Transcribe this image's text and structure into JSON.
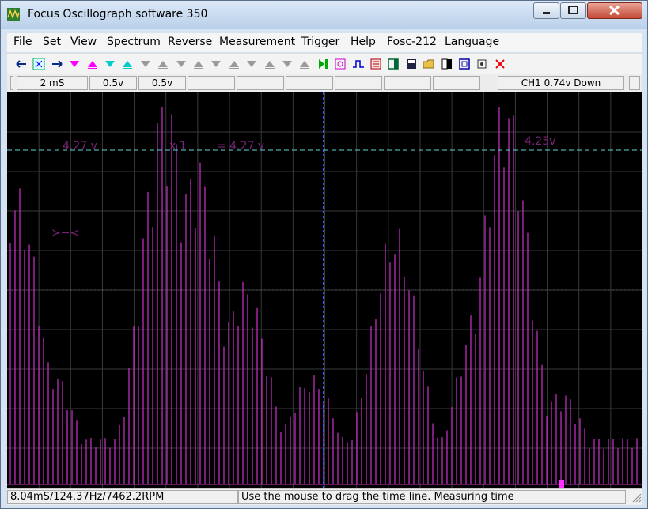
{
  "window": {
    "title": "Focus Oscillograph software 350"
  },
  "menu": [
    "File",
    "Set",
    "View",
    "Spectrum",
    "Reverse",
    "Measurement",
    "Trigger",
    "Help",
    "Fosc-212",
    "Language"
  ],
  "toolbar_icons": [
    "arrow-left-icon",
    "cursor-box-icon",
    "arrow-right-icon",
    "trigger-down-magenta-icon",
    "trigger-up-magenta-icon",
    "trigger-down-cyan-icon",
    "trigger-up-cyan-icon",
    "trigger-down-gray-icon",
    "trigger-up-gray-icon",
    "trigger-down-gray-icon",
    "trigger-up-gray-icon",
    "trigger-down-gray-icon",
    "trigger-up-gray-icon",
    "trigger-down-gray-icon",
    "trigger-up-gray-icon",
    "trigger-down-gray-icon",
    "trigger-up-gray-icon",
    "run-icon",
    "measure-icon",
    "pulse-icon",
    "list-icon",
    "panel-icon",
    "save-icon",
    "open-folder-icon",
    "contrast-icon",
    "screen-icon",
    "settings-icon",
    "close-x-icon"
  ],
  "fields": {
    "timebase": "2 mS",
    "ch1_volts": "0.5v",
    "ch2_volts": "0.5v",
    "trigger": "CH1 0.74v Down"
  },
  "scope": {
    "cursor_left_label": "4.27 v",
    "cursor_mid_label": "x 1",
    "cursor_eq_label": "= 4.27 v",
    "cursor_right_label": "4.25v",
    "marker_symbol": "≻−≺",
    "trace_color": "#cc33cc",
    "cursor_color": "#5fd3d3"
  },
  "status": {
    "left": "8.04mS/124.37Hz/7462.2RPM",
    "right": "Use the mouse to drag the time line. Measuring time"
  }
}
